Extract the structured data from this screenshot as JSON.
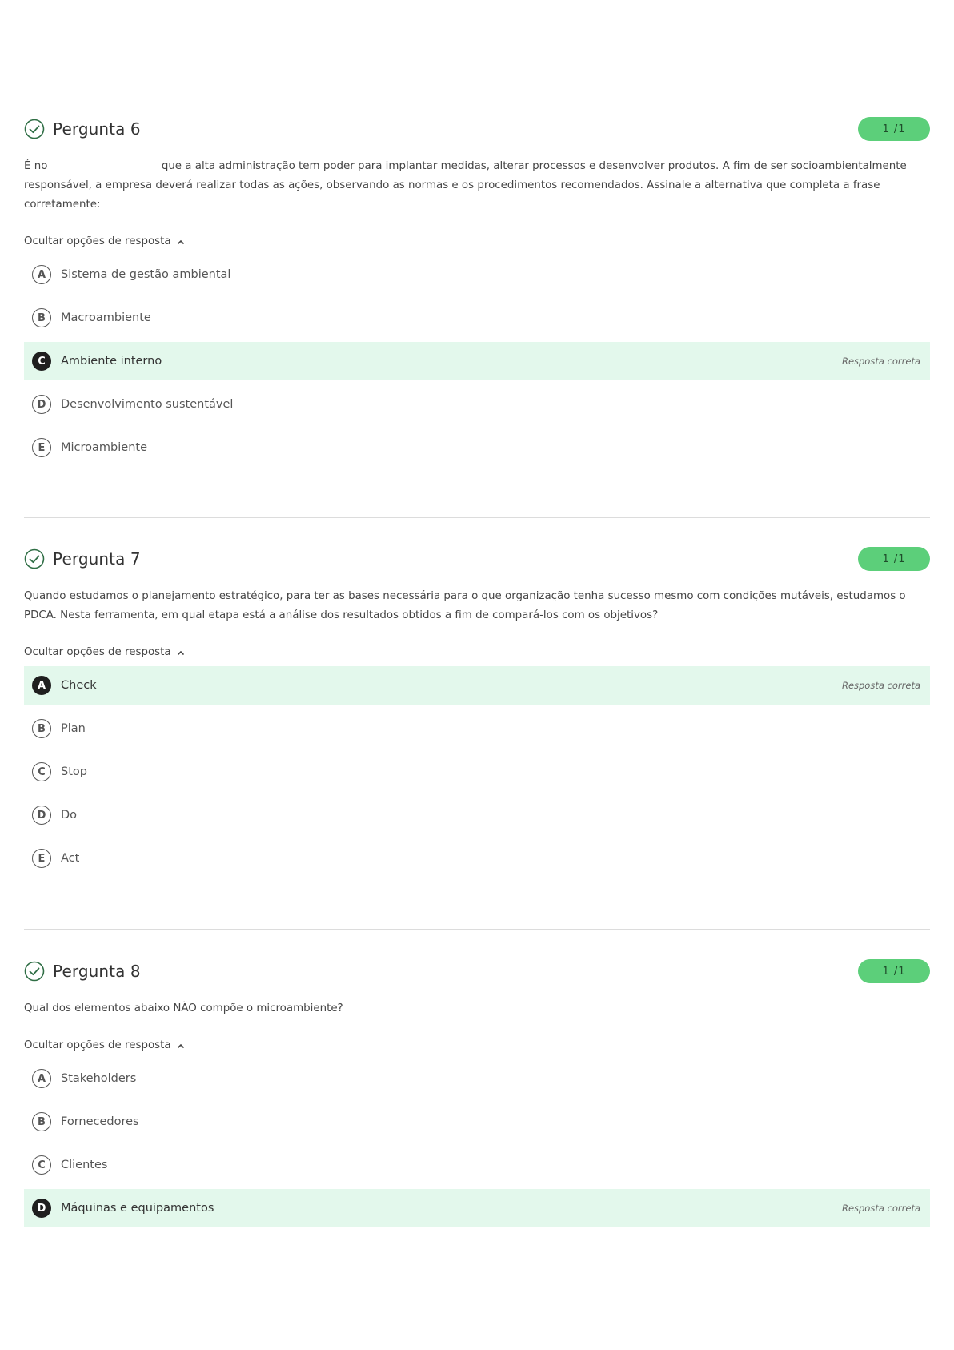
{
  "toggle_label": "Ocultar opções de resposta",
  "correct_label": "Resposta correta",
  "colors": {
    "badge_bg": "#5ccf7a",
    "correct_row_bg": "#e3f8ec",
    "check_icon": "#2f6e45"
  },
  "questions": [
    {
      "title": "Pergunta 6",
      "score": "1 /1",
      "text": "É no ____________________ que a alta administração tem poder para implantar medidas, alterar processos e desenvolver produtos. A fim de ser socioambientalmente responsável, a empresa deverá realizar todas as ações, observando as normas e os procedimentos recomendados. Assinale a alternativa que completa a frase corretamente:",
      "options": [
        {
          "letter": "A",
          "label": "Sistema de gestão ambiental",
          "correct": false
        },
        {
          "letter": "B",
          "label": "Macroambiente",
          "correct": false
        },
        {
          "letter": "C",
          "label": "Ambiente interno",
          "correct": true
        },
        {
          "letter": "D",
          "label": "Desenvolvimento sustentável",
          "correct": false
        },
        {
          "letter": "E",
          "label": "Microambiente",
          "correct": false
        }
      ]
    },
    {
      "title": "Pergunta 7",
      "score": "1 /1",
      "text": "Quando estudamos o planejamento estratégico, para ter as bases necessária para o que organização tenha sucesso mesmo com condições mutáveis, estudamos o PDCA. Nesta ferramenta, em qual etapa está a análise dos resultados obtidos a fim de compará-los com os objetivos?",
      "options": [
        {
          "letter": "A",
          "label": "Check",
          "correct": true
        },
        {
          "letter": "B",
          "label": "Plan",
          "correct": false
        },
        {
          "letter": "C",
          "label": "Stop",
          "correct": false
        },
        {
          "letter": "D",
          "label": "Do",
          "correct": false
        },
        {
          "letter": "E",
          "label": "Act",
          "correct": false
        }
      ]
    },
    {
      "title": "Pergunta 8",
      "score": "1 /1",
      "text": "Qual dos elementos abaixo NÃO compõe o microambiente?",
      "options": [
        {
          "letter": "A",
          "label": "Stakeholders",
          "correct": false
        },
        {
          "letter": "B",
          "label": "Fornecedores",
          "correct": false
        },
        {
          "letter": "C",
          "label": "Clientes",
          "correct": false
        },
        {
          "letter": "D",
          "label": "Máquinas e equipamentos",
          "correct": true
        }
      ]
    }
  ]
}
